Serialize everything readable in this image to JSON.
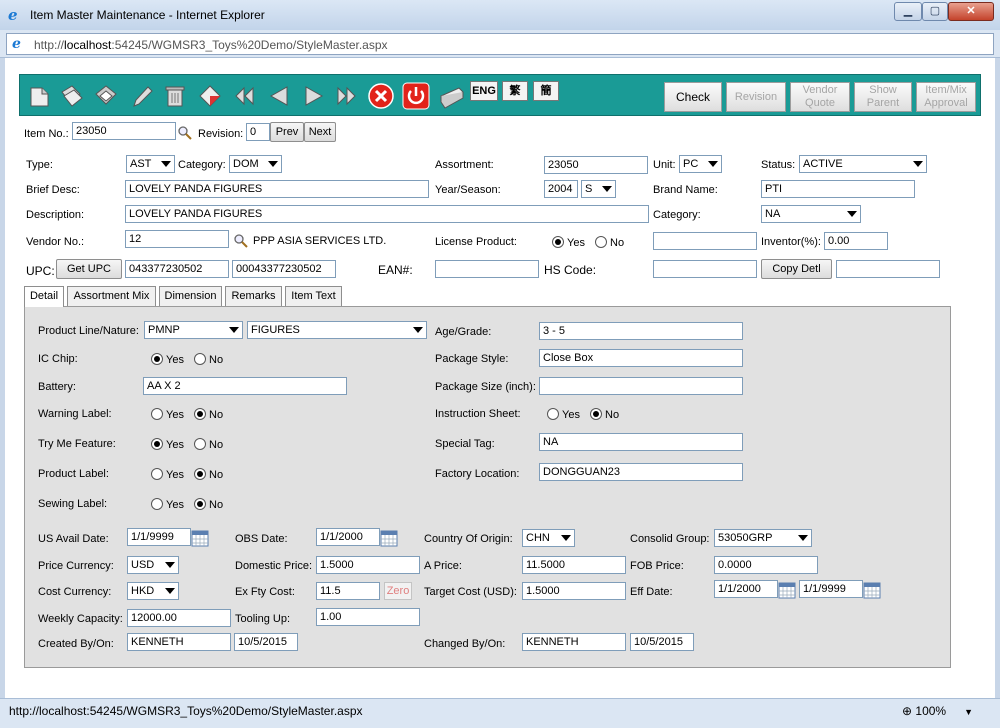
{
  "window": {
    "title": "Item Master Maintenance - Internet Explorer",
    "url_prefix": "http://",
    "url_host": "localhost",
    "url_rest": ":54245/WGMSR3_Toys%20Demo/StyleMaster.aspx",
    "status_url": "http://localhost:54245/WGMSR3_Toys%20Demo/StyleMaster.aspx",
    "zoom": "100%"
  },
  "toolbar": {
    "lang_eng": "ENG",
    "lang_trad": "繁",
    "lang_simp": "簡",
    "check": "Check",
    "revision": "Revision",
    "vendor_quote": "Vendor Quote",
    "show_parent": "Show Parent",
    "item_mix_approval": "Item/Mix Approval"
  },
  "header": {
    "item_no_label": "Item No.:",
    "item_no": "23050",
    "revision_label": "Revision:",
    "revision": "0",
    "prev": "Prev",
    "next": "Next",
    "type_label": "Type:",
    "type": "AST",
    "category_label": "Category:",
    "category": "DOM",
    "assortment_label": "Assortment:",
    "assortment": "23050",
    "unit_label": "Unit:",
    "unit": "PC",
    "status_label": "Status:",
    "status": "ACTIVE",
    "brief_desc_label": "Brief Desc:",
    "brief_desc": "LOVELY PANDA FIGURES",
    "year_season_label": "Year/Season:",
    "year": "2004",
    "season": "S",
    "brand_name_label": "Brand Name:",
    "brand_name": "PTI",
    "description_label": "Description:",
    "description": "LOVELY PANDA FIGURES",
    "category2_label": "Category:",
    "category2": "NA",
    "vendor_no_label": "Vendor No.:",
    "vendor_no": "12",
    "vendor_name": "PPP ASIA SERVICES LTD.",
    "license_label": "License Product:",
    "yes": "Yes",
    "no": "No",
    "inventor_label": "Inventor(%):",
    "inventor": "0.00",
    "upc_label": "UPC:",
    "get_upc": "Get UPC",
    "upc1": "043377230502",
    "upc2": "00043377230502",
    "ean_label": "EAN#:",
    "hs_code_label": "HS Code:",
    "copy_detl": "Copy Detl"
  },
  "tabs": [
    "Detail",
    "Assortment Mix",
    "Dimension",
    "Remarks",
    "Item Text"
  ],
  "detail": {
    "product_line_label": "Product Line/Nature:",
    "product_line": "PMNP",
    "nature": "FIGURES",
    "age_grade_label": "Age/Grade:",
    "age_grade": "3 - 5",
    "ic_chip_label": "IC Chip:",
    "package_style_label": "Package Style:",
    "package_style": "Close Box",
    "battery_label": "Battery:",
    "battery": "AA X 2",
    "package_size_label": "Package Size (inch):",
    "package_size": "",
    "warning_label": "Warning Label:",
    "instruction_label": "Instruction Sheet:",
    "try_me_label": "Try Me Feature:",
    "special_tag_label": "Special Tag:",
    "special_tag": "NA",
    "product_label_label": "Product Label:",
    "factory_location_label": "Factory Location:",
    "factory_location": "DONGGUAN23",
    "sewing_label": "Sewing Label:",
    "us_avail_label": "US Avail Date:",
    "us_avail": "1/1/9999",
    "obs_date_label": "OBS Date:",
    "obs_date": "1/1/2000",
    "country_label": "Country Of Origin:",
    "country": "CHN",
    "consolid_label": "Consolid Group:",
    "consolid": "53050GRP",
    "price_currency_label": "Price Currency:",
    "price_currency": "USD",
    "domestic_price_label": "Domestic Price:",
    "domestic_price": "1.5000",
    "a_price_label": "A Price:",
    "a_price": "11.5000",
    "fob_price_label": "FOB Price:",
    "fob_price": "0.0000",
    "cost_currency_label": "Cost Currency:",
    "cost_currency": "HKD",
    "ex_fty_label": "Ex Fty Cost:",
    "ex_fty": "11.5",
    "zero": "Zero",
    "target_cost_label": "Target Cost (USD):",
    "target_cost": "1.5000",
    "eff_date_label": "Eff Date:",
    "eff_from": "1/1/2000",
    "eff_to": "1/1/9999",
    "weekly_capacity_label": "Weekly Capacity:",
    "weekly_capacity": "12000.00",
    "tooling_up_label": "Tooling Up:",
    "tooling_up": "1.00",
    "created_label": "Created By/On:",
    "created_by": "KENNETH",
    "created_on": "10/5/2015",
    "changed_label": "Changed By/On:",
    "changed_by": "KENNETH",
    "changed_on": "10/5/2015"
  }
}
